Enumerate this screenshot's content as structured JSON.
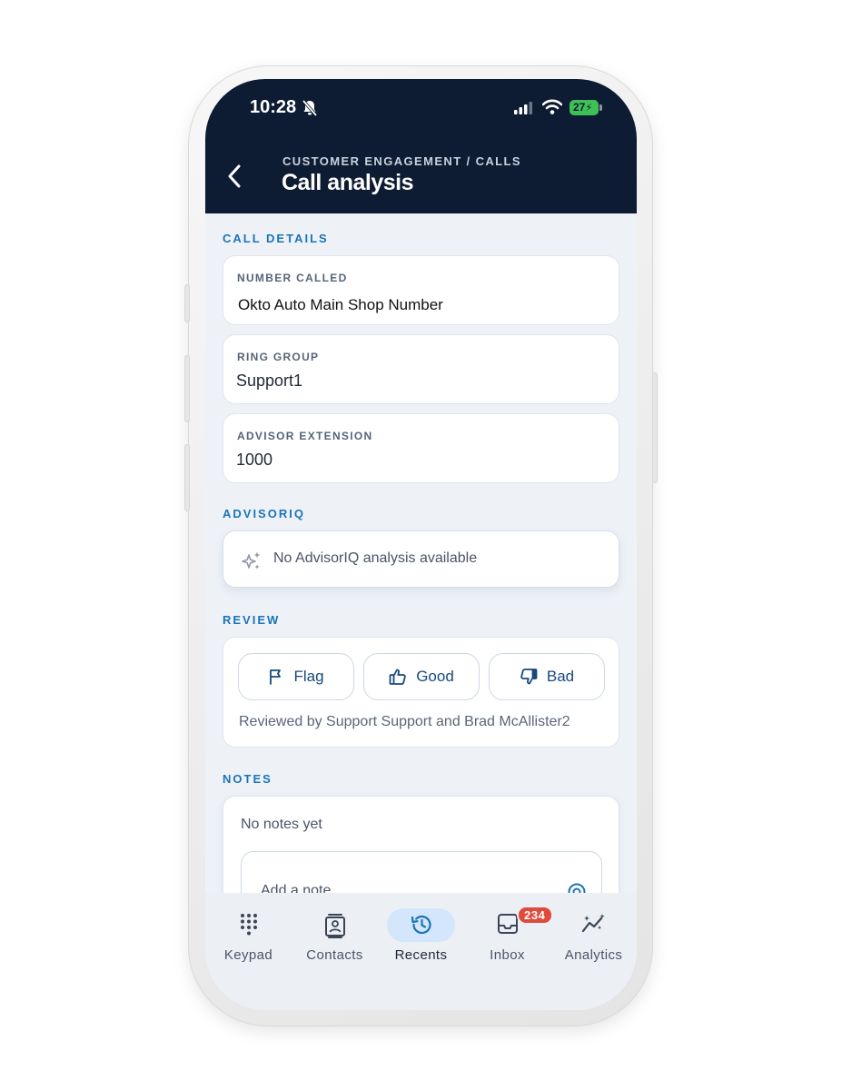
{
  "status_bar": {
    "time": "10:28",
    "battery": "27"
  },
  "header": {
    "breadcrumb": "CUSTOMER ENGAGEMENT / CALLS",
    "title": "Call analysis"
  },
  "call_details": {
    "section_label": "CALL DETAILS",
    "fields": [
      {
        "label": "NUMBER CALLED",
        "value": "Okto Auto Main Shop Number"
      },
      {
        "label": "RING GROUP",
        "value": "Support1"
      },
      {
        "label": "ADVISOR EXTENSION",
        "value": "1000"
      }
    ]
  },
  "advisoriq": {
    "section_label": "ADVISORIQ",
    "empty_text": "No AdvisorIQ analysis available"
  },
  "review": {
    "section_label": "REVIEW",
    "buttons": [
      {
        "label": "Flag",
        "icon": "flag-icon"
      },
      {
        "label": "Good",
        "icon": "thumbs-up-icon"
      },
      {
        "label": "Bad",
        "icon": "thumbs-down-icon"
      }
    ],
    "reviewed_by": "Reviewed by Support Support and Brad McAllister2"
  },
  "notes": {
    "section_label": "NOTES",
    "empty_text": "No notes yet",
    "input_placeholder": "Add a note"
  },
  "tabbar": {
    "active": "Recents",
    "tabs": [
      {
        "label": "Keypad",
        "icon": "keypad-icon"
      },
      {
        "label": "Contacts",
        "icon": "contacts-icon"
      },
      {
        "label": "Recents",
        "icon": "recents-icon"
      },
      {
        "label": "Inbox",
        "icon": "inbox-icon",
        "badge": "234"
      },
      {
        "label": "Analytics",
        "icon": "analytics-icon"
      }
    ]
  },
  "colors": {
    "header_bg": "#0d1b33",
    "accent": "#1a74b8",
    "badge": "#e04a3b",
    "active_tab_pill": "#d3e6fb"
  }
}
